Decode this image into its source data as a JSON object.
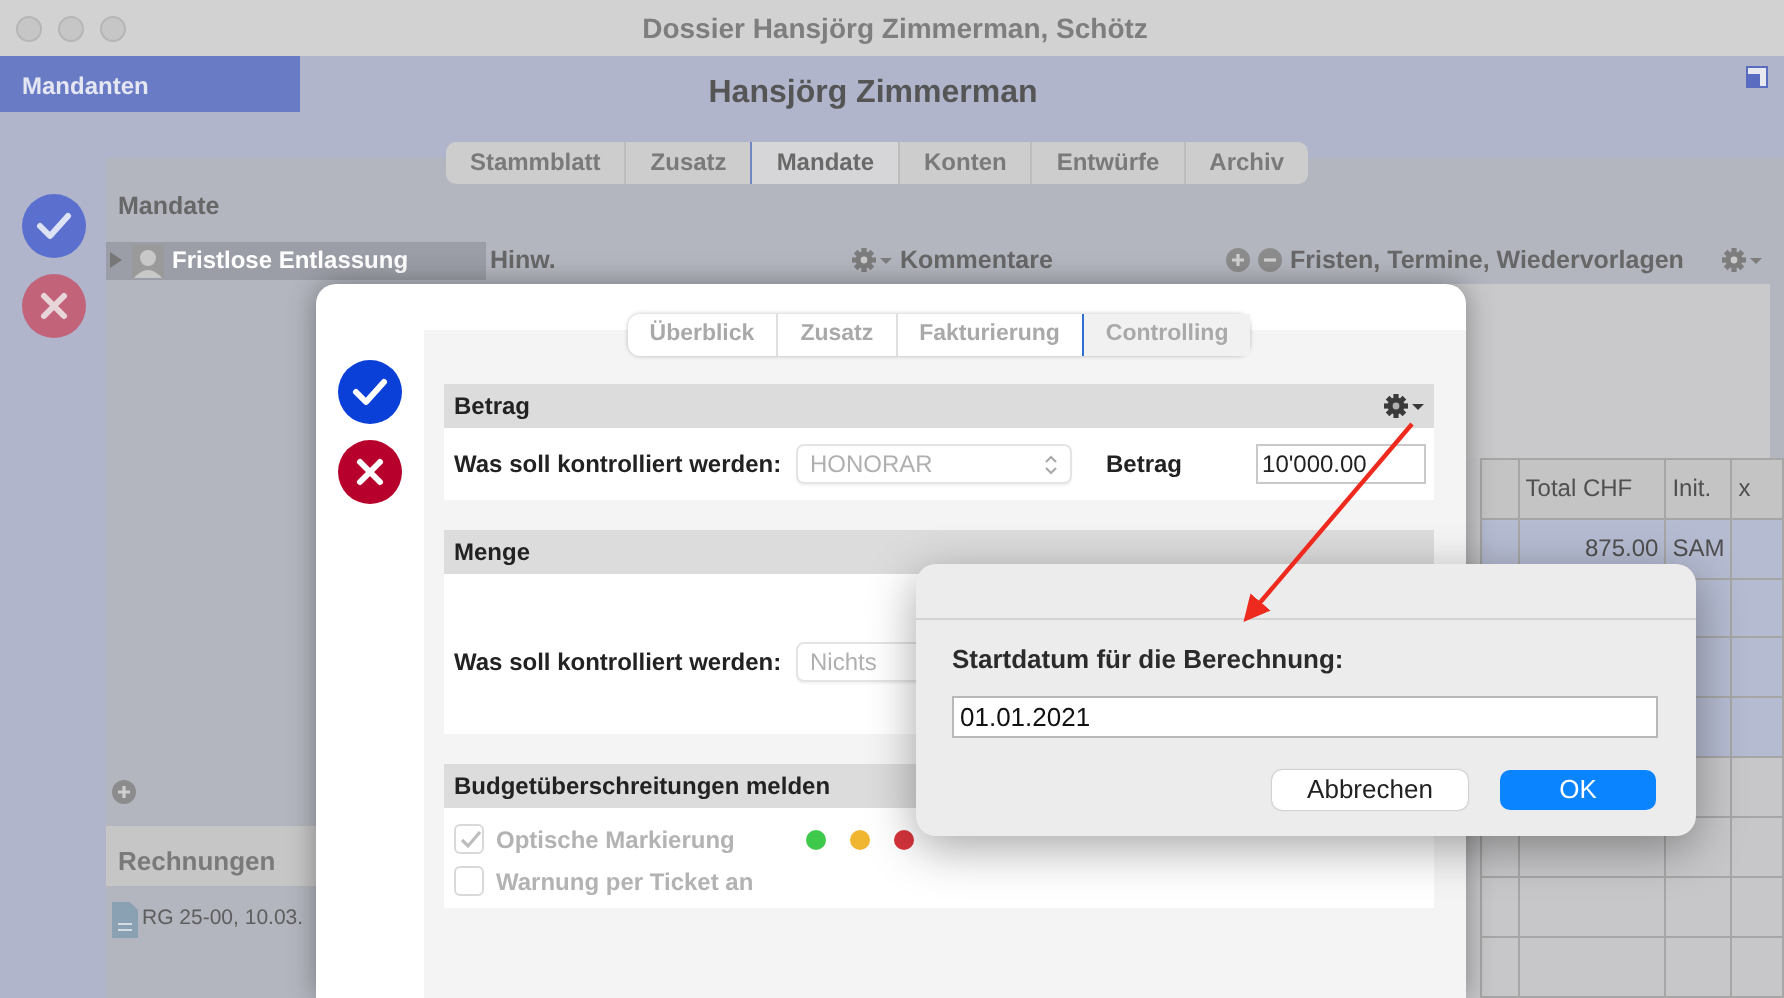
{
  "window": {
    "title": "Dossier Hansjörg Zimmerman, Schötz"
  },
  "sidebar_tab": {
    "label": "Mandanten",
    "selected": true
  },
  "header": {
    "title": "Hansjörg Zimmerman"
  },
  "tabs": [
    {
      "label": "Stammblatt",
      "selected": false
    },
    {
      "label": "Zusatz",
      "selected": false
    },
    {
      "label": "Mandate",
      "selected": true
    },
    {
      "label": "Konten",
      "selected": false
    },
    {
      "label": "Entwürfe",
      "selected": false
    },
    {
      "label": "Archiv",
      "selected": false
    }
  ],
  "mandate": {
    "title": "Mandate",
    "items": [
      {
        "label": "Fristlose Entlassung",
        "selected": true
      }
    ]
  },
  "panels": [
    {
      "title": "Hinw.",
      "kind": "gear"
    },
    {
      "title": "Kommentare",
      "kind": "plusminus"
    },
    {
      "title": "Fristen, Termine, Wiedervorlagen",
      "kind": "gear"
    }
  ],
  "table": {
    "columns": [
      "Total CHF",
      "Init.",
      "x"
    ],
    "rows": [
      {
        "cells": [
          "875.00",
          "SAM"
        ],
        "selected": true
      },
      {
        "selected": true
      },
      {
        "selected": true
      },
      {
        "selected": true
      },
      {
        "selected": false
      },
      {
        "selected": false
      },
      {
        "selected": false
      },
      {
        "selected": false
      }
    ]
  },
  "rechnungen": {
    "title": "Rechnungen",
    "items": [
      {
        "label": "RG 25-00, 10.03."
      }
    ]
  },
  "sheet": {
    "tabs": [
      {
        "label": "Überblick",
        "selected": false
      },
      {
        "label": "Zusatz",
        "selected": false
      },
      {
        "label": "Fakturierung",
        "selected": false
      },
      {
        "label": "Controlling",
        "selected": true
      }
    ],
    "sections": [
      {
        "kind": "amount",
        "title": "Betrag",
        "label": "Was soll kontrolliert werden:",
        "select": "HONORAR",
        "amount_label": "Betrag",
        "amount": "10'000.00"
      },
      {
        "kind": "select",
        "title": "Menge",
        "label": "Was soll kontrolliert werden:",
        "select": "Nichts"
      },
      {
        "kind": "checks",
        "title": "Budgetüberschreitungen melden",
        "checks": [
          {
            "label": "Optische Markierung",
            "checked": true,
            "dots": [
              {
                "color": "#3fc94c"
              },
              {
                "color": "#f0b631"
              },
              {
                "color": "#d8343c"
              }
            ]
          },
          {
            "label": "Warnung per Ticket an",
            "checked": false
          }
        ]
      }
    ]
  },
  "prompt": {
    "label": "Startdatum für die Berechnung:",
    "value": "01.01.2021",
    "buttons": [
      {
        "label": "Abbrechen",
        "kind": "secondary"
      },
      {
        "label": "OK",
        "kind": "primary"
      }
    ]
  }
}
